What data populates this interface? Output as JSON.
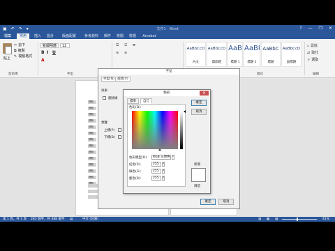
{
  "window": {
    "title": "文件1 - Word",
    "controls": [
      "?",
      "—",
      "❐",
      "✕"
    ],
    "qat_icons": [
      "save-icon",
      "undo-icon",
      "redo-icon",
      "customize-icon"
    ]
  },
  "tabs": [
    {
      "label": "檔案",
      "kind": "file"
    },
    {
      "label": "常用",
      "kind": "active"
    },
    {
      "label": "插入",
      "kind": ""
    },
    {
      "label": "設計",
      "kind": ""
    },
    {
      "label": "版面配置",
      "kind": ""
    },
    {
      "label": "參考資料",
      "kind": ""
    },
    {
      "label": "郵件",
      "kind": ""
    },
    {
      "label": "校閱",
      "kind": ""
    },
    {
      "label": "檢視",
      "kind": ""
    },
    {
      "label": "Acrobat",
      "kind": ""
    }
  ],
  "ribbon": {
    "clipboard": {
      "paste": "貼上",
      "cut": "剪下",
      "copy": "複製",
      "format_painter": "複製格式",
      "group_label": "剪貼簿"
    },
    "font": {
      "font_name": "新細明體",
      "font_size": "12",
      "group_label": "字型",
      "buttons": [
        "B",
        "I",
        "U",
        "A"
      ]
    },
    "paragraph": {
      "group_label": "段落"
    },
    "styles": {
      "group_label": "樣式",
      "items": [
        {
          "sample": "AaBbCcD",
          "name": "內文"
        },
        {
          "sample": "AaBbCcD",
          "name": "無間距"
        },
        {
          "sample": "AaB",
          "name": "標題 1"
        },
        {
          "sample": "AaBl",
          "name": "標題 2"
        },
        {
          "sample": "AaBbC",
          "name": "標題"
        },
        {
          "sample": "AaBbCcD",
          "name": "副標題"
        }
      ]
    },
    "editing": {
      "find": "尋找",
      "replace": "取代",
      "select": "選取",
      "group_label": "編輯"
    }
  },
  "doc": {
    "side_labels": [
      "標題",
      "標題",
      "標題",
      "標題",
      "標題",
      "標題",
      "標題",
      "標題",
      "標題",
      "標題",
      "標題",
      "標題",
      "標題",
      "標題"
    ]
  },
  "font_dialog": {
    "title": "字型",
    "tabs": [
      "字型(N)",
      "進階(V)"
    ],
    "section_effects": "效果",
    "strikethrough": "刪除線",
    "preview_label": "預覽",
    "superscript": "上標(P)",
    "subscript": "下標(B)"
  },
  "color_dialog": {
    "title": "色彩",
    "tabs": [
      "標準",
      "自訂"
    ],
    "colors_label": "色彩(D):",
    "model_label": "色彩模型(D):",
    "model_value": "RGB 三原色",
    "red_label": "紅色(R):",
    "red": "255",
    "green_label": "綠色(G):",
    "green": "255",
    "blue_label": "藍色(B):",
    "blue": "255",
    "ok": "確定",
    "cancel": "取消",
    "new_label": "新增",
    "current_label": "目前",
    "close_glyph": "✕"
  },
  "dialog_buttons": {
    "ok": "確定",
    "cancel": "取消"
  },
  "status": {
    "page": "第 1 頁，共 1 頁",
    "words": "285 個字，共 488 個字",
    "lang": "中文 (台灣)",
    "zoom": "41%"
  },
  "colors": {
    "accent": "#2b579a",
    "ribbon_bg": "#f3f3f3",
    "close_red": "#c75050"
  }
}
